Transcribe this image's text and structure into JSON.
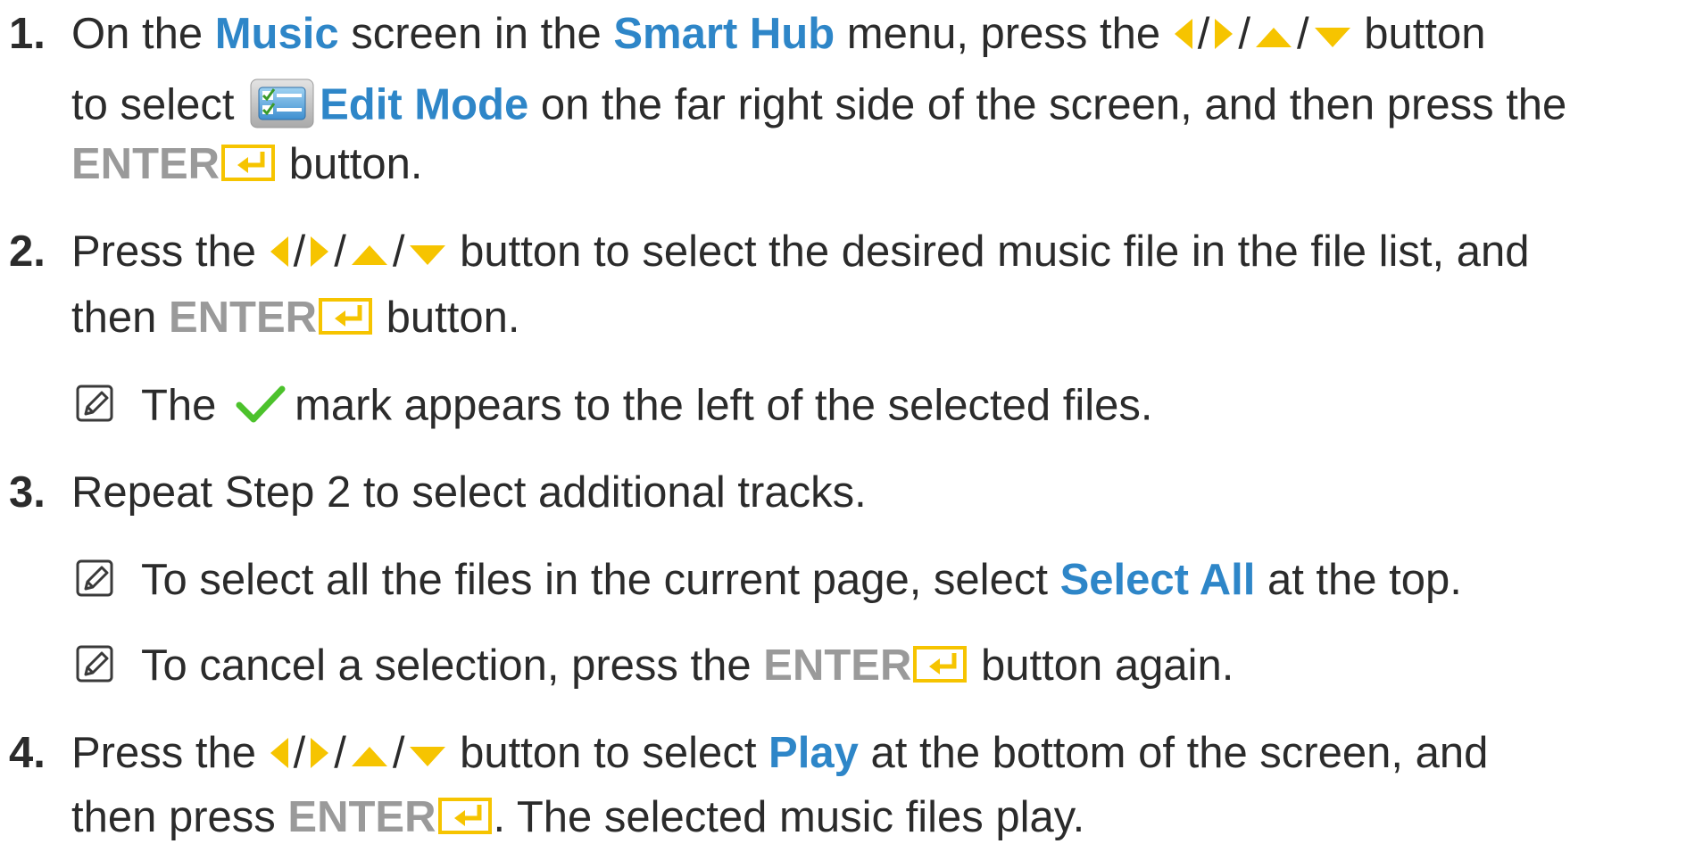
{
  "colors": {
    "keyword": "#2e86c8",
    "enter": "#9a9a9a",
    "arrow": "#f6c400",
    "check": "#4cc22c",
    "text": "#2b2b2b"
  },
  "step1": {
    "number": "1.",
    "l1_a": "On the ",
    "l1_music": "Music",
    "l1_b": " screen in the ",
    "l1_smarthub": "Smart Hub",
    "l1_c": " menu, press the ",
    "l1_d": " button",
    "l2_a": "to select ",
    "l2_editmode": "Edit Mode",
    "l2_b": " on the far right side of the screen, and then press the",
    "l3_enter": "ENTER",
    "l3_b": " button."
  },
  "step2": {
    "number": "2.",
    "l1_a": "Press the ",
    "l1_b": " button to select the desired music file in the file list, and",
    "l2_a": "then ",
    "l2_enter": "ENTER",
    "l2_b": " button.",
    "note_a": "The ",
    "note_b": "mark appears to the left of the selected files."
  },
  "step3": {
    "number": "3.",
    "l1": "Repeat Step 2 to select additional tracks.",
    "note1_a": "To select all the files in the current page, select ",
    "note1_kw": "Select All",
    "note1_b": " at the top.",
    "note2_a": "To cancel a selection, press the ",
    "note2_enter": "ENTER",
    "note2_b": " button again."
  },
  "step4": {
    "number": "4.",
    "l1_a": "Press the ",
    "l1_b": " button to select ",
    "l1_play": "Play",
    "l1_c": " at the bottom of the screen, and",
    "l2_a": "then press ",
    "l2_enter": "ENTER",
    "l2_b": ". The selected music files play."
  },
  "separator": "/",
  "icons": [
    "left-arrow-icon",
    "right-arrow-icon",
    "up-arrow-icon",
    "down-arrow-icon",
    "enter-icon",
    "edit-mode-icon",
    "note-icon",
    "checkmark-icon"
  ]
}
